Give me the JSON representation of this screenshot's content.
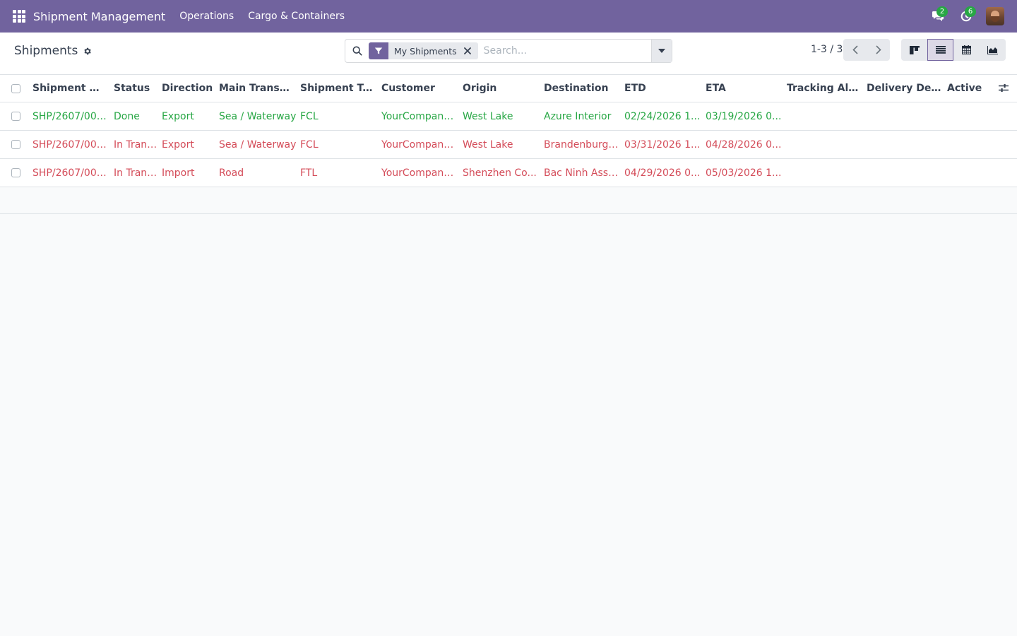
{
  "navbar": {
    "app_name": "Shipment Management",
    "menus": [
      "Operations",
      "Cargo & Containers"
    ],
    "messages_count": "2",
    "activities_count": "6",
    "color": "#71639e"
  },
  "control_panel": {
    "title": "Shipments",
    "search": {
      "facet_label": "My Shipments",
      "placeholder": "Search..."
    },
    "pager": "1-3 / 3",
    "views": [
      "kanban",
      "list",
      "calendar",
      "graph"
    ],
    "active_view": "list"
  },
  "list": {
    "columns": [
      "Shipment R...",
      "Status",
      "Direction",
      "Main Transp...",
      "Shipment Ty...",
      "Customer",
      "Origin",
      "Destination",
      "ETD",
      "ETA",
      "Tracking Alert",
      "Delivery Del...",
      "Active"
    ],
    "rows": [
      {
        "ref": "SHP/2607/000...",
        "status": "Done",
        "direction": "Export",
        "transport": "Sea / Waterway",
        "type": "FCL",
        "customer": "YourCompany,...",
        "origin": "West Lake",
        "destination": "Azure Interior",
        "etd": "02/24/2026 1...",
        "eta": "03/19/2026 0..."
      },
      {
        "ref": "SHP/2607/000...",
        "status": "In Transit",
        "direction": "Export",
        "transport": "Sea / Waterway",
        "type": "FCL",
        "customer": "YourCompany,...",
        "origin": "West Lake",
        "destination": "Brandenburge...",
        "etd": "03/31/2026 1...",
        "eta": "04/28/2026 0..."
      },
      {
        "ref": "SHP/2607/000...",
        "status": "In Transit",
        "direction": "Import",
        "transport": "Road",
        "type": "FTL",
        "customer": "YourCompany,...",
        "origin": "Shenzhen Co...",
        "destination": "Bac Ninh Asse...",
        "etd": "04/29/2026 0...",
        "eta": "05/03/2026 1..."
      }
    ],
    "status_colors": {
      "Done": "#28a745",
      "In Transit": "#d44c59"
    }
  }
}
